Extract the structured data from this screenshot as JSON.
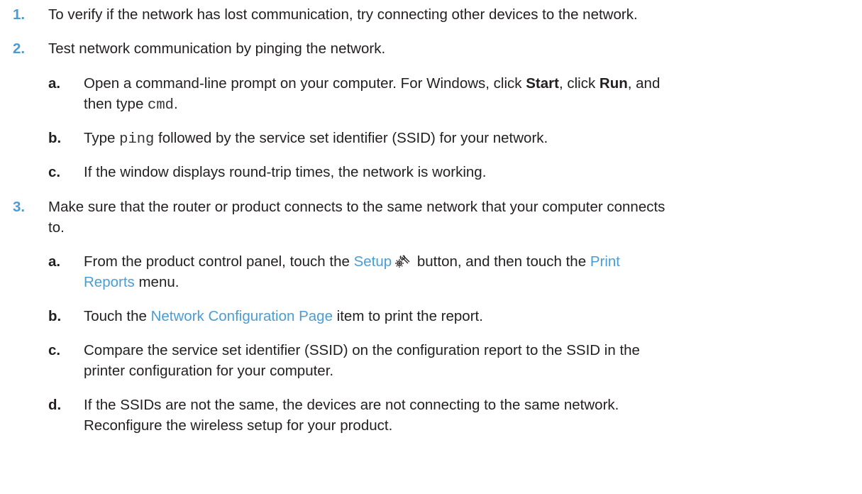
{
  "steps": [
    {
      "num": "1.",
      "text": "To verify if the network has lost communication, try connecting other devices to the network."
    },
    {
      "num": "2.",
      "text": "Test network communication by pinging the network.",
      "substeps": [
        {
          "letter": "a.",
          "pre": "Open a command-line prompt on your computer. For Windows, click ",
          "start": "Start",
          "mid": ", click ",
          "run": "Run",
          "post": ", and",
          "line2_pre": "then type ",
          "code": "cmd",
          "line2_post": "."
        },
        {
          "letter": "b.",
          "pre": "Type ",
          "code": "ping",
          "post": " followed by the service set identifier (SSID) for your network."
        },
        {
          "letter": "c.",
          "text": "If the window displays round-trip times, the network is working."
        }
      ]
    },
    {
      "num": "3.",
      "line1": "Make sure that the router or product connects to the same network that your computer connects",
      "line2": "to.",
      "substeps": [
        {
          "letter": "a.",
          "pre": "From the product control panel, touch the ",
          "setup": "Setup",
          "mid": " button, and then touch the ",
          "print": "Print",
          "reports": "Reports",
          "post": " menu."
        },
        {
          "letter": "b.",
          "pre": "Touch the ",
          "link": "Network Configuration Page",
          "post": " item to print the report."
        },
        {
          "letter": "c.",
          "line1": "Compare the service set identifier (SSID) on the configuration report to the SSID in the",
          "line2": "printer configuration for your computer."
        },
        {
          "letter": "d.",
          "line1": "If the SSIDs are not the same, the devices are not connecting to the same network.",
          "line2": "Reconfigure the wireless setup for your product."
        }
      ]
    }
  ],
  "icons": {
    "setup": "setup-wrench-gear-icon"
  },
  "colors": {
    "link": "#4a9dd4",
    "step_number": "#4a9dd4",
    "text": "#231f20"
  }
}
